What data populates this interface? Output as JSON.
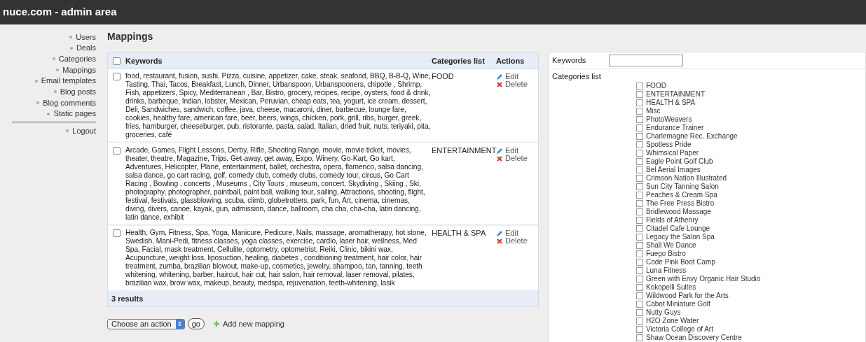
{
  "header": {
    "title": "nuce.com - admin area"
  },
  "sidebar": {
    "items": [
      {
        "label": "Users"
      },
      {
        "label": "Deals"
      },
      {
        "label": "Categories"
      },
      {
        "label": "Mappings"
      },
      {
        "label": "Email templates"
      },
      {
        "label": "Blog posts"
      },
      {
        "label": "Blog comments"
      },
      {
        "label": "Static pages"
      }
    ],
    "footer_items": [
      {
        "label": "Logout"
      }
    ]
  },
  "page_title": "Mappings",
  "table": {
    "select_all_checked": false,
    "columns": [
      "Keywords",
      "Categories list",
      "Actions"
    ],
    "rows": [
      {
        "checked": false,
        "keywords": "food, restaurant, fusion, sushi, Pizza, cuisine, appetizer, cake, steak, seafood, BBQ, B-B-Q, Wine, Tasting, Thai, Tacos, Breakfast, Lunch, Dinner, Urbanspoon, Urbanspooners, chipotle , Shrimp, Fish, appetizers, Spicy, Mediterranean , Bar, Bistro, grocery, recipes, recipe, oysters, food & drink, drinks, barbeque, Indian, lobster, Mexican, Peruvian, cheap eats, tea, yogurt, ice cream, dessert, Deli, Sandwiches, sandwich, coffee, java, cheese, macaroni, diner, barbecue, lounge fare, cookies, healthy fare, american fare, beer, beers, wings, chicken, pork, grill, ribs, burger, greek, fries, hamburger, cheeseburger, pub, ristorante, pasta, salad, Italian, dried fruit, nuts, teriyaki, pita, groceries, café",
        "category": "FOOD",
        "actions": [
          "Edit",
          "Delete"
        ]
      },
      {
        "checked": false,
        "keywords": "Arcade, Games, Flight Lessons, Derby, Rifle, Shooting Range, movie, movie ticket, movies, theater, theatre, Magazine, Trips, Get-away, get away, Expo, Winery, Go-Kart, Go kart, Adventures, Helicopter, Plane, entertainment, ballet, orchestra, opera, flamenco, salsa dancing, salsa dance, go cart racing, golf, comedy club, comedy clubs, comedy tour, circus, Go Cart Racing , Bowling , concerts , Museums , City Tours , museum, concert, Skydiving , Skiing , Ski, photography, photographer, paintball, paint ball, walking tour, sailing, Attractions, shooting, flight, festival, festivals, glassblowing, scuba, climb, globetrotters, park, fun, Art, cinema, cinemas, diving, divers, canoe, kayak, gun, admission, dance, ballroom, cha cha, cha-cha, latin dancing, latin dance, exhibit",
        "category": "ENTERTAINMENT",
        "actions": [
          "Edit",
          "Delete"
        ]
      },
      {
        "checked": false,
        "keywords": "Health, Gym, Fitness, Spa, Yoga, Manicure, Pedicure, Nails, massage, aromatherapy, hot stone, Swedish, Mani-Pedi, fitness classes, yoga classes, exercise, cardio, laser hair, wellness, Med Spa, Facial, mask treatment, Cellulite, optometry, optometrist, Reiki, Clinic, bikini wax, Acupuncture, weight loss, liposuction, healing, diabetes , conditioning treatment, hair color, hair treatment, zumba, brazilian blowout, make-up, cosmetics, jewelry, shampoo, tan, tanning, teeth whitening, whitening, barber, haircut, hair cut, hair salon, hair removal, laser removal, pilates, brazilian wax, brow wax, makeup, beauty, medspa, rejuvenation, teeth-whitening, lasik",
        "category": "HEALTH & SPA",
        "actions": [
          "Edit",
          "Delete"
        ]
      }
    ],
    "results": "3 results"
  },
  "bulk": {
    "select_value": "Choose an action",
    "go_button": "go",
    "add_link": "Add new mapping"
  },
  "filter": {
    "keywords_label": "Keywords",
    "categories_label": "Categories list",
    "categories": [
      {
        "label": "FOOD",
        "checked": false
      },
      {
        "label": "ENTERTAINMENT",
        "checked": false
      },
      {
        "label": "HEALTH & SPA",
        "checked": false
      },
      {
        "label": "Misc",
        "checked": false
      },
      {
        "label": "PhotoWeavers",
        "checked": false
      },
      {
        "label": "Endurance Trainer",
        "checked": false
      },
      {
        "label": "Charlemagne Rec. Exchange",
        "checked": false
      },
      {
        "label": "Spotless Pride",
        "checked": false
      },
      {
        "label": "Whimsical Paper",
        "checked": false
      },
      {
        "label": "Eagle Point Golf Club",
        "checked": false
      },
      {
        "label": "Bel Aerial Images",
        "checked": false
      },
      {
        "label": "Crimson Nation Illustrated",
        "checked": false
      },
      {
        "label": "Sun City Tanning Salon",
        "checked": false
      },
      {
        "label": "Peaches & Cream Spa",
        "checked": false
      },
      {
        "label": "The Free Press Bistro",
        "checked": false
      },
      {
        "label": "Bridlewood Massage",
        "checked": false
      },
      {
        "label": "Fields of Athenry",
        "checked": false
      },
      {
        "label": "Citadel Cafe Lounge",
        "checked": false
      },
      {
        "label": "Legacy the Salon Spa",
        "checked": false
      },
      {
        "label": "Shall We Dance",
        "checked": false
      },
      {
        "label": "Fuego Bistro",
        "checked": false
      },
      {
        "label": "Code Pink Boot Camp",
        "checked": false
      },
      {
        "label": "Luna Fitness",
        "checked": false
      },
      {
        "label": "Green with Envy Organic Hair Studio",
        "checked": false
      },
      {
        "label": "Kokopelli Suites",
        "checked": false
      },
      {
        "label": "Wildwood Park for the Arts",
        "checked": false
      },
      {
        "label": "Cabot Miniature Golf",
        "checked": false
      },
      {
        "label": "Nutty Guys",
        "checked": false
      },
      {
        "label": "H2O Zone Water",
        "checked": false
      },
      {
        "label": "Victoria College of Art",
        "checked": false
      },
      {
        "label": "Shaw Ocean Discovery Centre",
        "checked": false
      }
    ]
  }
}
